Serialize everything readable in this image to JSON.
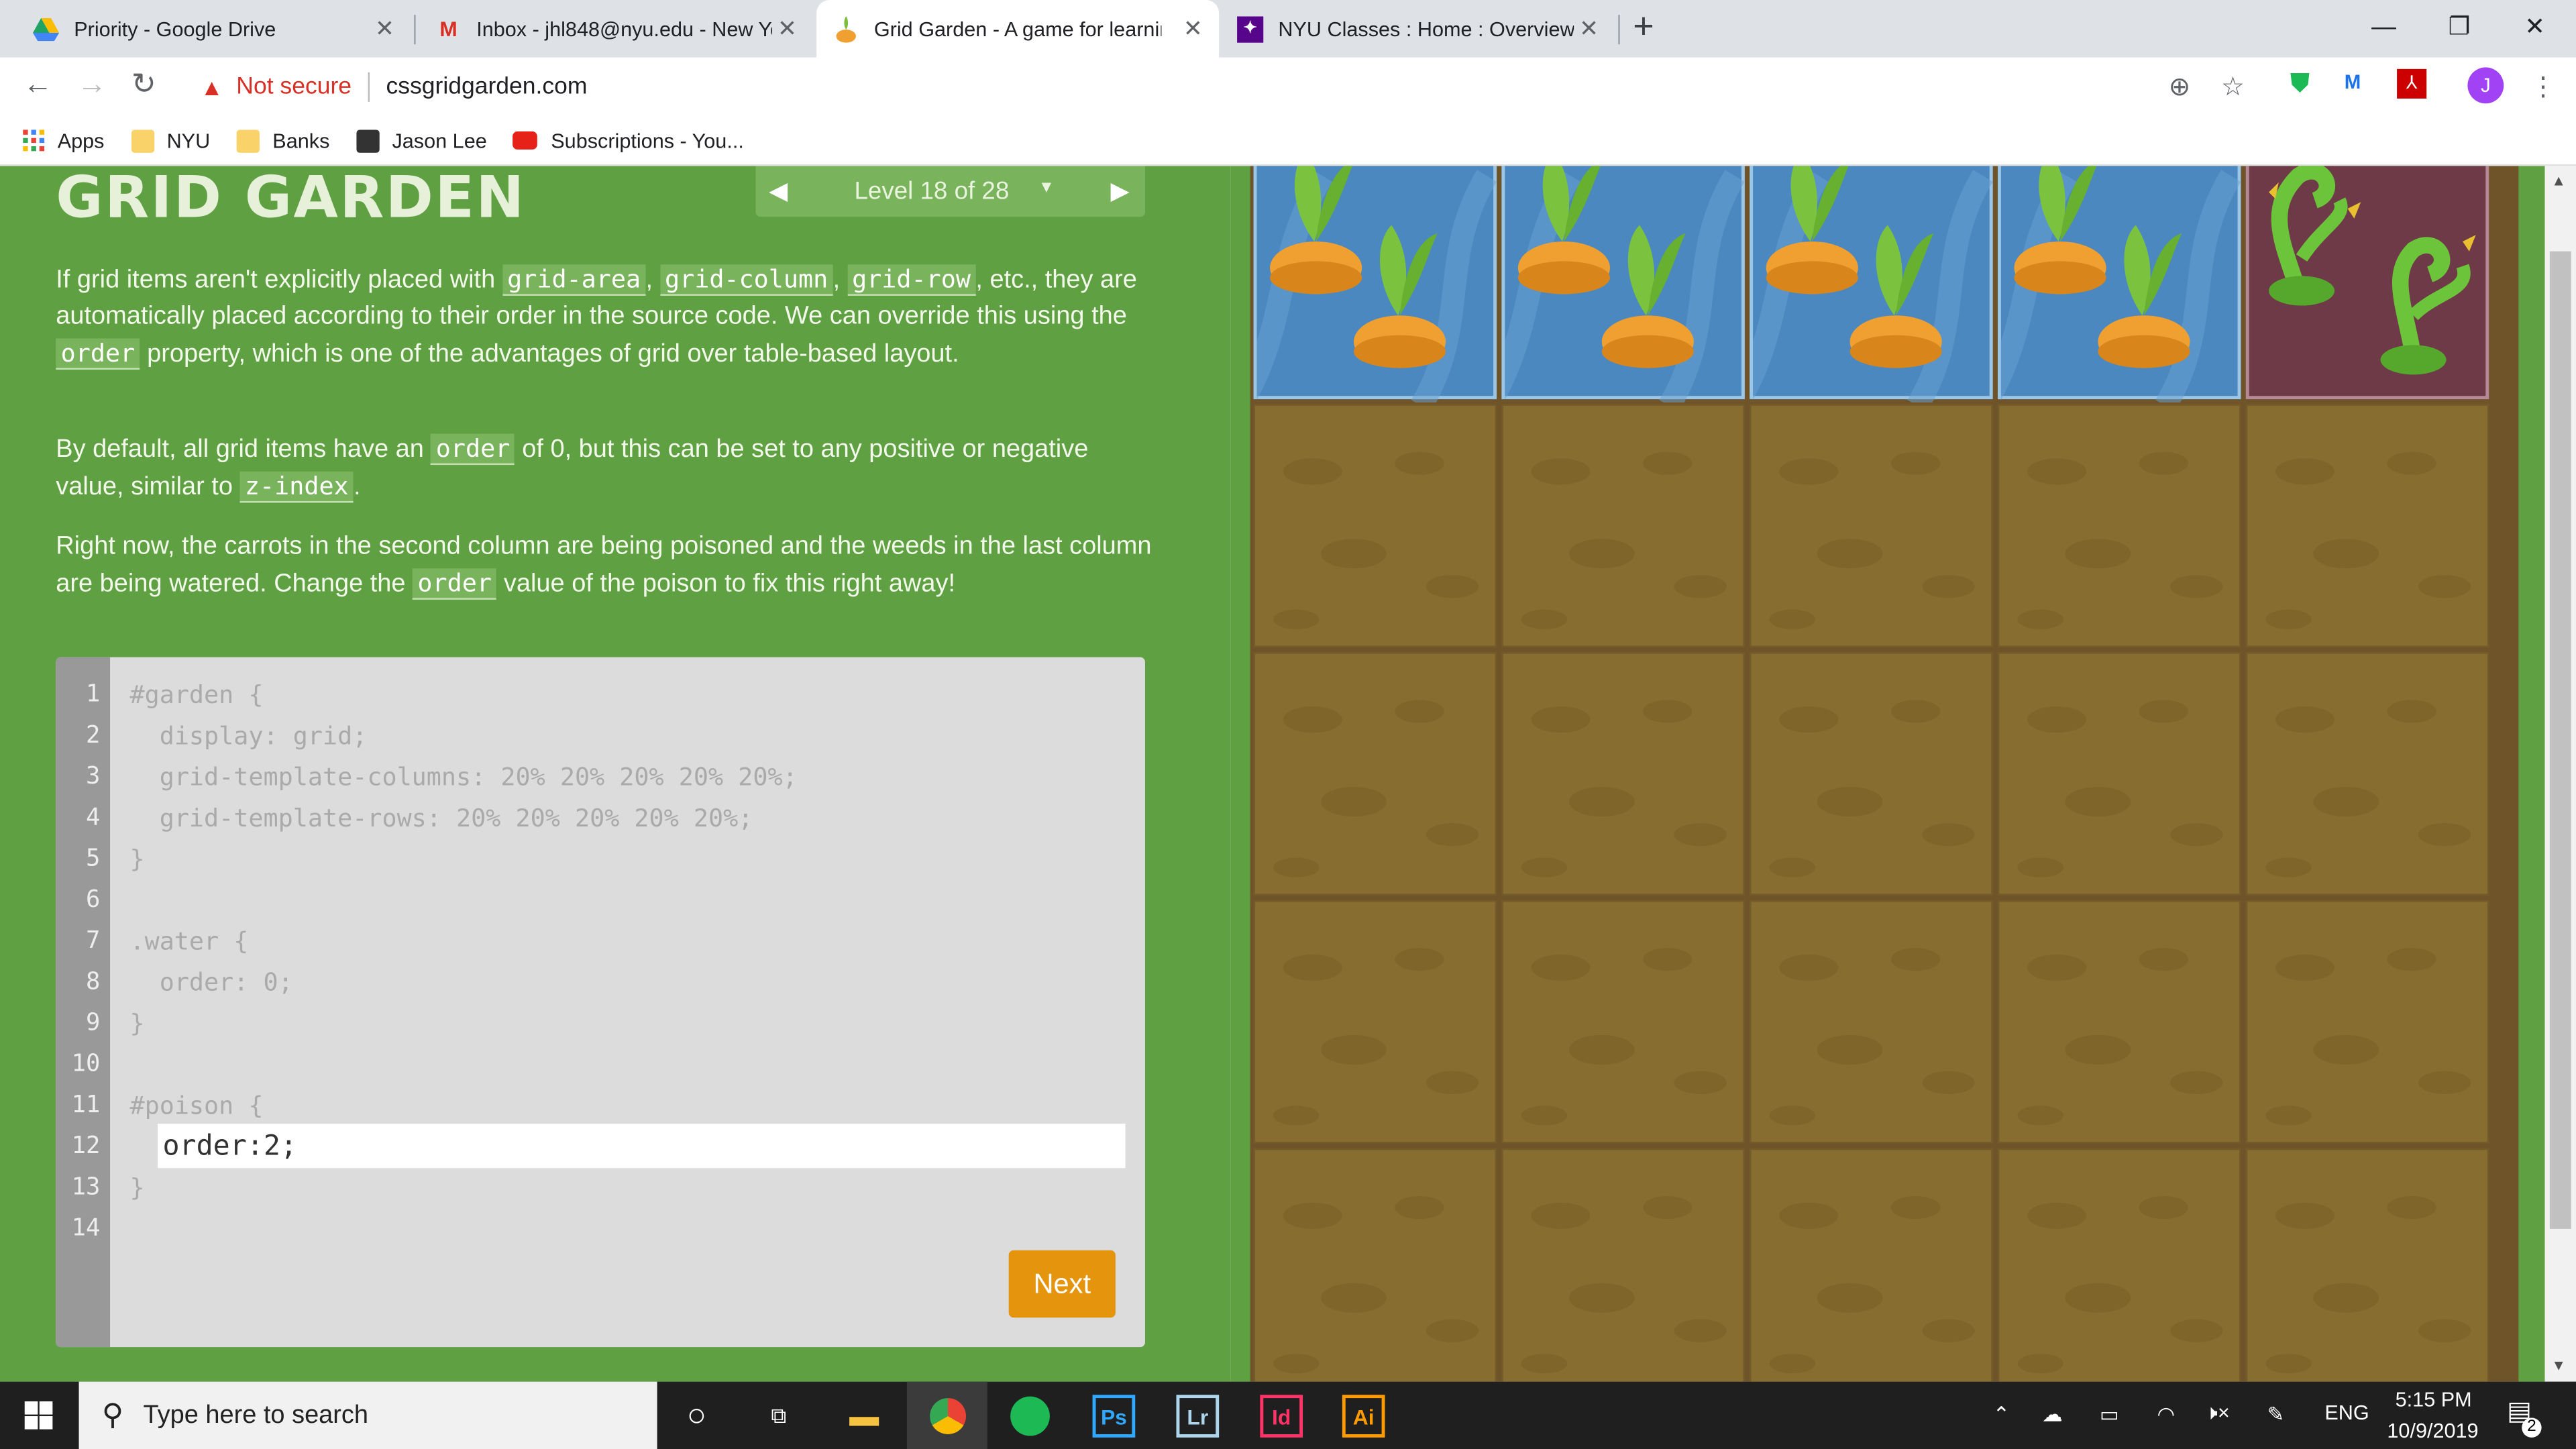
{
  "browser": {
    "tabs": [
      {
        "title": "Priority - Google Drive",
        "icon": "google-drive-icon"
      },
      {
        "title": "Inbox - jhl848@nyu.edu - New Yo",
        "icon": "gmail-icon"
      },
      {
        "title": "Grid Garden - A game for learnin",
        "icon": "grid-garden-icon",
        "active": true
      },
      {
        "title": "NYU Classes : Home : Overview",
        "icon": "nyu-icon"
      }
    ],
    "security_label": "Not secure",
    "url": "cssgridgarden.com",
    "bookmarks": [
      "Apps",
      "NYU",
      "Banks",
      "Jason Lee",
      "Subscriptions - You..."
    ],
    "profile_initial": "J"
  },
  "game": {
    "title": "GRID GARDEN",
    "level_label": "Level 18 of 28",
    "intro": {
      "t1": "If grid items aren't explicitly placed with ",
      "c1": "grid-area",
      "t2": ", ",
      "c2": "grid-column",
      "t3": ", ",
      "c3": "grid-row",
      "t4": ", etc., they are automatically placed according to their order in the source code. We can override this using the ",
      "c4": "order",
      "t5": " property, which is one of the advantages of grid over table-based layout."
    },
    "para2": {
      "t1": "By default, all grid items have an ",
      "c1": "order",
      "t2": " of 0, but this can be set to any positive or negative value, similar to ",
      "c2": "z-index",
      "t3": "."
    },
    "para3": {
      "t1": "Right now, the carrots in the second column are being poisoned and the weeds in the last column are being watered. Change the ",
      "c1": "order",
      "t2": " value of the poison to fix this right away!"
    },
    "code_lines": [
      "#garden {",
      "  display: grid;",
      "  grid-template-columns: 20% 20% 20% 20% 20%;",
      "  grid-template-rows: 20% 20% 20% 20% 20%;",
      "}",
      "",
      ".water {",
      "  order: 0;",
      "}",
      "",
      "#poison {",
      "",
      "}",
      ""
    ],
    "line_numbers": [
      "1",
      "2",
      "3",
      "4",
      "5",
      "6",
      "7",
      "8",
      "9",
      "10",
      "11",
      "12",
      "13",
      "14"
    ],
    "input_value": "order:2;",
    "next_label": "Next",
    "colors": {
      "green": "#5fa043",
      "soil": "#886d30",
      "water": "#4b88c0",
      "poison": "#6e3a48",
      "carrot": "#f0a030",
      "next": "#e5940d"
    }
  },
  "taskbar": {
    "search_placeholder": "Type here to search",
    "apps": [
      "Ps",
      "Lr",
      "Id",
      "Ai"
    ],
    "language": "ENG",
    "time": "5:15 PM",
    "date": "10/9/2019",
    "notification_count": "2"
  }
}
